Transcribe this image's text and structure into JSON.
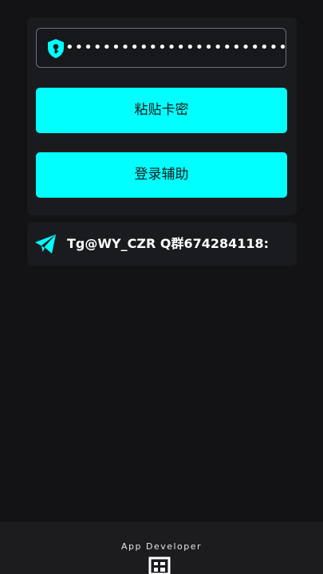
{
  "login": {
    "key_value": "••••••••••••••••••••••••••",
    "paste_button_label": "粘贴卡密",
    "login_button_label": "登录辅助"
  },
  "contact": {
    "text": "Tg@WY_CZR   Q群674284118:"
  },
  "footer": {
    "developer_label": "App Developer"
  },
  "icons": {
    "key_field_icon": "shield-keyhole-icon",
    "contact_icon": "telegram-icon",
    "footer_icon": "developer-app-icon"
  },
  "colors": {
    "accent": "#00ffff",
    "background": "#131315",
    "card": "#1a1b1e"
  }
}
